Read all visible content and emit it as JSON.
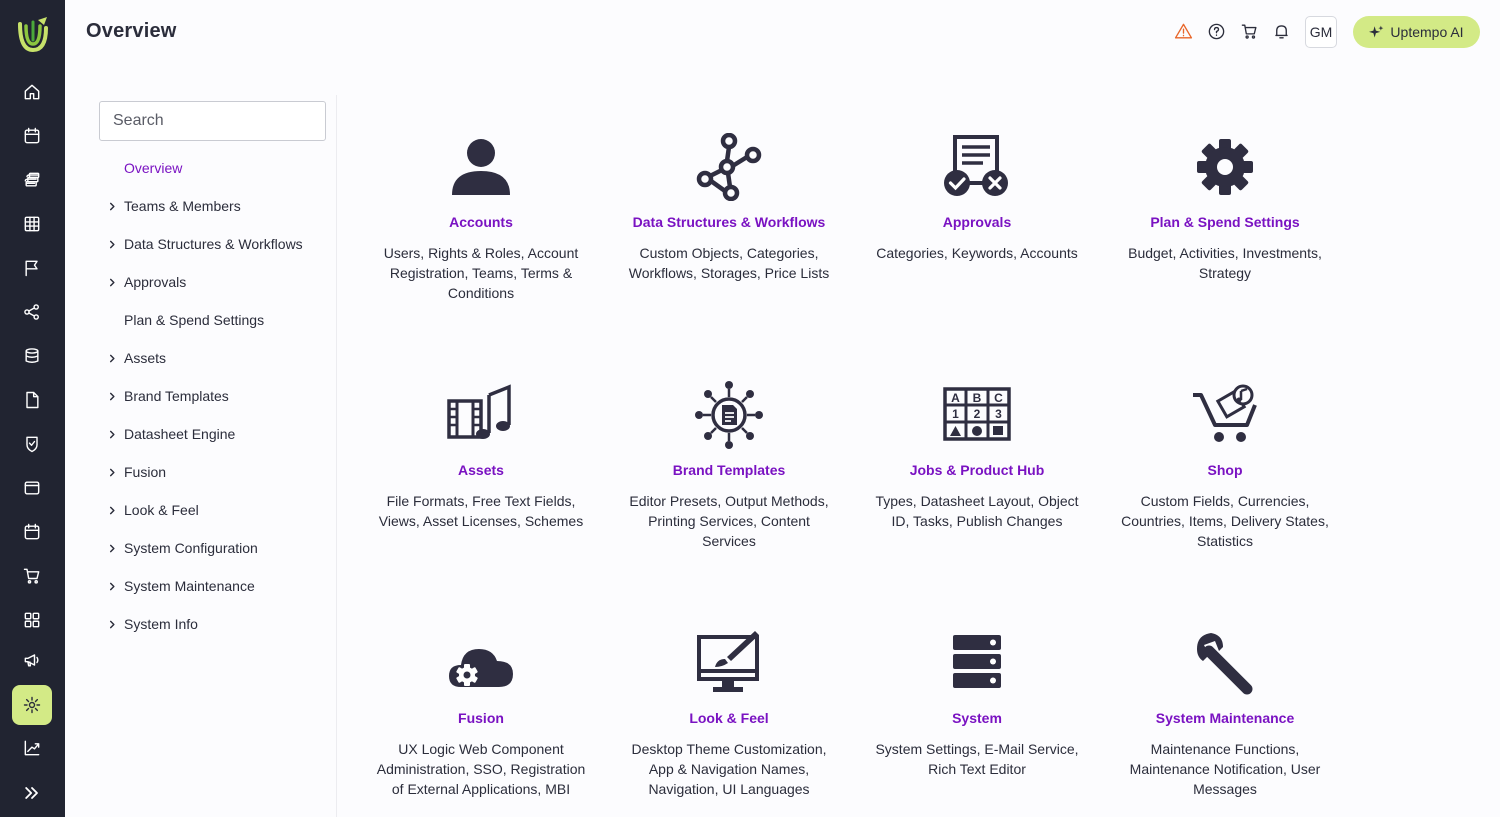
{
  "header": {
    "title": "Overview",
    "avatar_initials": "GM",
    "ai_button_label": "Uptempo AI",
    "warning_color": "#e8662a"
  },
  "rail": {
    "items": [
      "home-icon",
      "calendar-icon",
      "stack-icon",
      "grid-table-icon",
      "flag-icon",
      "share-nodes-icon",
      "database-icon",
      "document-icon",
      "shield-check-icon",
      "browser-window-icon",
      "calendar-alt-icon",
      "cart-icon",
      "apps-grid-icon",
      "megaphone-icon",
      "settings-gear-icon",
      "chart-growth-icon",
      "expand-chevrons-icon"
    ],
    "active": "settings-gear-icon"
  },
  "search": {
    "placeholder": "Search"
  },
  "nav": {
    "items": [
      {
        "label": "Overview",
        "chevron": false,
        "active": true
      },
      {
        "label": "Teams & Members",
        "chevron": true
      },
      {
        "label": "Data Structures & Workflows",
        "chevron": true
      },
      {
        "label": "Approvals",
        "chevron": true
      },
      {
        "label": "Plan & Spend Settings",
        "chevron": false
      },
      {
        "label": "Assets",
        "chevron": true
      },
      {
        "label": "Brand Templates",
        "chevron": true
      },
      {
        "label": "Datasheet Engine",
        "chevron": true
      },
      {
        "label": "Fusion",
        "chevron": true
      },
      {
        "label": "Look & Feel",
        "chevron": true
      },
      {
        "label": "System Configuration",
        "chevron": true
      },
      {
        "label": "System Maintenance",
        "chevron": true
      },
      {
        "label": "System Info",
        "chevron": true
      }
    ]
  },
  "tiles": [
    {
      "icon": "user-icon",
      "title": "Accounts",
      "desc": "Users, Rights & Roles, Account Registration, Teams, Terms & Conditions"
    },
    {
      "icon": "workflow-nodes-icon",
      "title": "Data Structures & Workflows",
      "desc": "Custom Objects, Categories, Workflows, Storages, Price Lists"
    },
    {
      "icon": "approval-document-icon",
      "title": "Approvals",
      "desc": "Categories, Keywords, Accounts"
    },
    {
      "icon": "gear-icon",
      "title": "Plan & Spend Settings",
      "desc": "Budget, Activities, Investments, Strategy"
    },
    {
      "icon": "film-music-icon",
      "title": "Assets",
      "desc": "File Formats, Free Text Fields, Views, Asset Licenses, Schemes"
    },
    {
      "icon": "template-hub-icon",
      "title": "Brand Templates",
      "desc": "Editor Presets, Output Methods, Printing Services, Content Services"
    },
    {
      "icon": "datasheet-grid-icon",
      "title": "Jobs & Product Hub",
      "desc": "Types, Datasheet Layout, Object ID, Tasks, Publish Changes"
    },
    {
      "icon": "shop-cart-icon",
      "title": "Shop",
      "desc": "Custom Fields, Currencies, Countries, Items, Delivery States, Statistics"
    },
    {
      "icon": "cloud-gear-icon",
      "title": "Fusion",
      "desc": "UX Logic Web Component Administration, SSO, Registration of External Applications, MBI"
    },
    {
      "icon": "monitor-brush-icon",
      "title": "Look & Feel",
      "desc": "Desktop Theme Customization, App & Navigation Names, Navigation, UI Languages"
    },
    {
      "icon": "server-icon",
      "title": "System",
      "desc": "System Settings, E-Mail Service, Rich Text Editor"
    },
    {
      "icon": "wrench-icon",
      "title": "System Maintenance",
      "desc": "Maintenance Functions, Maintenance Notification, User Messages"
    }
  ],
  "jobs_grid_labels": [
    "A",
    "B",
    "C",
    "1",
    "2",
    "3"
  ],
  "colors": {
    "rail_bg": "#212431",
    "accent": "#7a12c2",
    "highlight": "#d3ea86",
    "icon_dark": "#2f2e41"
  }
}
